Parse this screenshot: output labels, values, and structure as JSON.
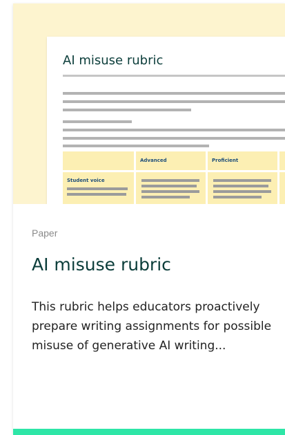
{
  "card": {
    "thumbnail": {
      "doc_title": "AI misuse rubric",
      "table": {
        "headers": [
          "",
          "Advanced",
          "Proficient"
        ],
        "first_row_label": "Student voice"
      }
    },
    "category": "Paper",
    "title": "AI misuse rubric",
    "description": "This rubric helps educators proactively prepare writing assignments for possible misuse of generative AI writing...",
    "colors": {
      "thumbnail_bg": "#fdf4cf",
      "title": "#0b3d3a",
      "accent_bar": "#2ee6a7"
    }
  }
}
